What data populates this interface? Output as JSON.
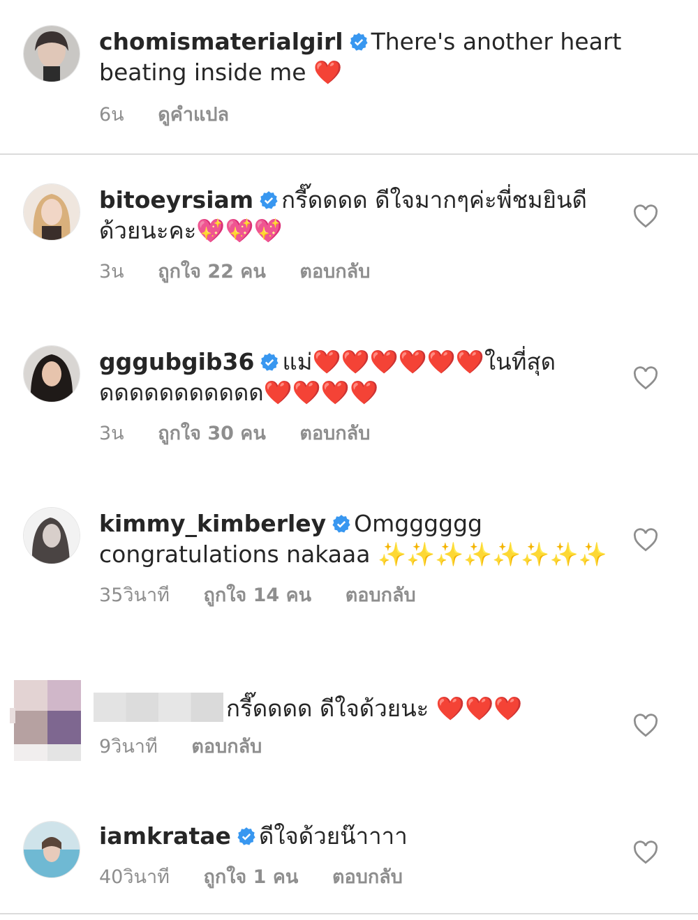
{
  "post_comment": {
    "username": "chomismaterialgirl",
    "text": "There's another heart beating inside me ❤️",
    "time": "6น",
    "translate": "ดูคำแปล"
  },
  "comments": [
    {
      "username": "bitoeyrsiam",
      "verified": true,
      "text": "กรี๊ดดดด ดีใจมากๆค่ะพี่ชมยินดีด้วยนะคะ💖💖💖",
      "time": "3น",
      "likes": "ถูกใจ 22 คน",
      "reply": "ตอบกลับ"
    },
    {
      "username": "gggubgib36",
      "verified": true,
      "text": "แม่❤️❤️❤️❤️❤️❤️ในที่สุดดดดดดดดดดดด❤️❤️❤️❤️",
      "time": "3น",
      "likes": "ถูกใจ 30 คน",
      "reply": "ตอบกลับ"
    },
    {
      "username": "kimmy_kimberley",
      "verified": true,
      "text": "Omgggggg congratulations nakaaa ✨✨✨✨✨✨✨✨",
      "time": "35วินาที",
      "likes": "ถูกใจ 14 คน",
      "reply": "ตอบกลับ"
    },
    {
      "username": "",
      "verified": false,
      "text": "กรี๊ดดดด ดีใจด้วยนะ ❤️❤️❤️",
      "time": "9วินาที",
      "likes": "",
      "reply": "ตอบกลับ"
    },
    {
      "username": "iamkratae",
      "verified": true,
      "text": "ดีใจด้วยน๊าาาา",
      "time": "40วินาที",
      "likes": "ถูกใจ 1 คน",
      "reply": "ตอบกลับ"
    }
  ],
  "icons": {
    "verified": "verified-badge-icon",
    "like": "heart-outline-icon"
  },
  "colors": {
    "verified": "#3897f0",
    "meta": "#8e8e8e",
    "text": "#262626",
    "divider": "#dbdbdb"
  }
}
